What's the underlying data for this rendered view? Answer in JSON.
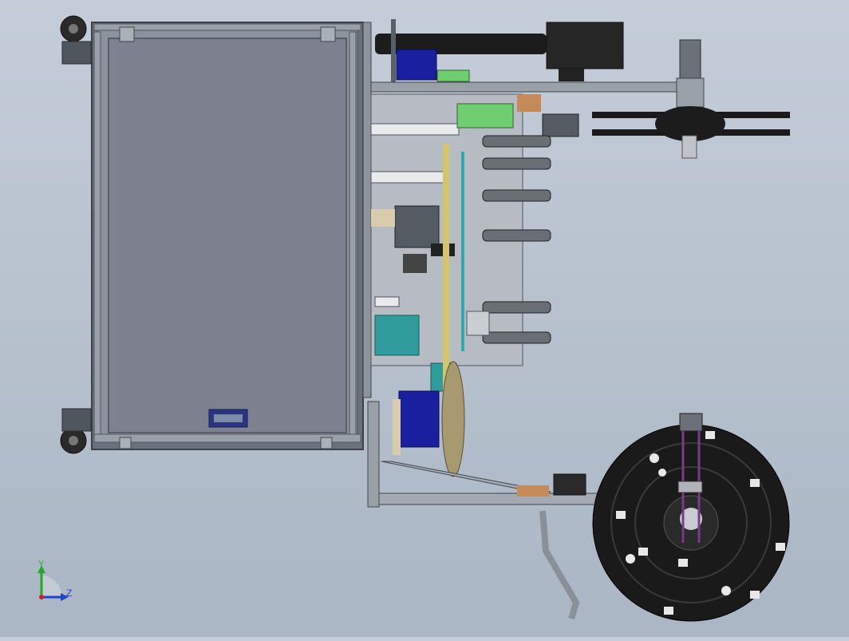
{
  "triad": {
    "y_label": "Y",
    "z_label": "Z",
    "y_color": "#22aa22",
    "z_color": "#2244cc",
    "origin_color": "#cc2222"
  },
  "colors": {
    "background": "#b8c2ce",
    "frame": "#5c6470",
    "panel": "#7c8190",
    "reel": "#1a1a1a",
    "motor_blue": "#1a1fa0",
    "teal_block": "#2f9b9b",
    "green_plate": "#6fcf6f",
    "brown_part": "#c48a5a",
    "tan_wheel": "#a89a70"
  }
}
